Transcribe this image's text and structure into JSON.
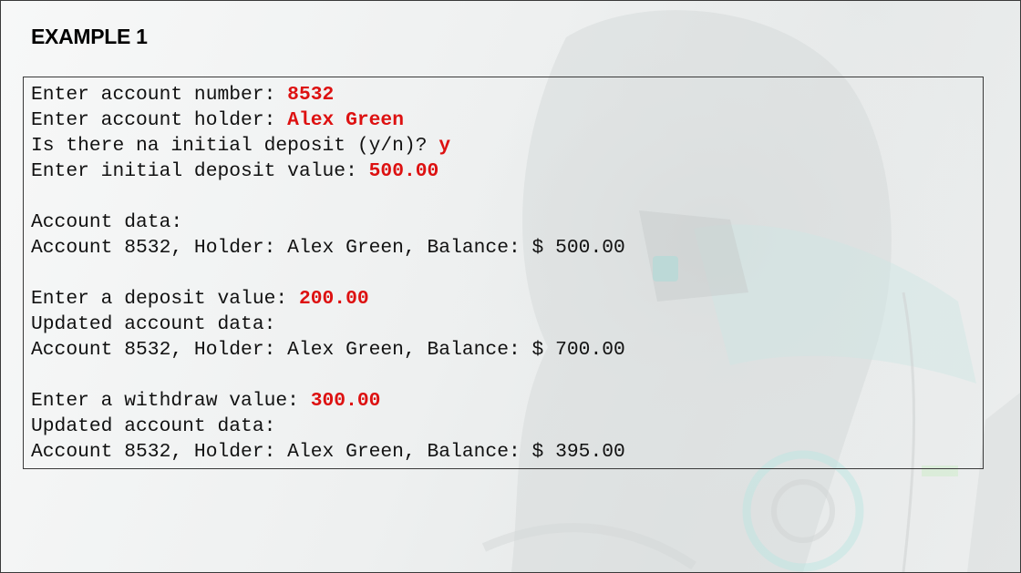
{
  "title": "EXAMPLE 1",
  "colors": {
    "input_text": "#dd1111",
    "output_text": "#111111"
  },
  "console": {
    "lines": [
      {
        "prompt": "Enter account number: ",
        "input": "8532"
      },
      {
        "prompt": "Enter account holder: ",
        "input": "Alex Green"
      },
      {
        "prompt": "Is there na initial deposit (y/n)? ",
        "input": "y"
      },
      {
        "prompt": "Enter initial deposit value: ",
        "input": "500.00"
      },
      {
        "prompt": "",
        "input": ""
      },
      {
        "prompt": "Account data:",
        "input": ""
      },
      {
        "prompt": "Account 8532, Holder: Alex Green, Balance: $ 500.00",
        "input": ""
      },
      {
        "prompt": "",
        "input": ""
      },
      {
        "prompt": "Enter a deposit value: ",
        "input": "200.00"
      },
      {
        "prompt": "Updated account data:",
        "input": ""
      },
      {
        "prompt": "Account 8532, Holder: Alex Green, Balance: $ 700.00",
        "input": ""
      },
      {
        "prompt": "",
        "input": ""
      },
      {
        "prompt": "Enter a withdraw value: ",
        "input": "300.00"
      },
      {
        "prompt": "Updated account data:",
        "input": ""
      },
      {
        "prompt": "Account 8532, Holder: Alex Green, Balance: $ 395.00",
        "input": ""
      }
    ]
  }
}
